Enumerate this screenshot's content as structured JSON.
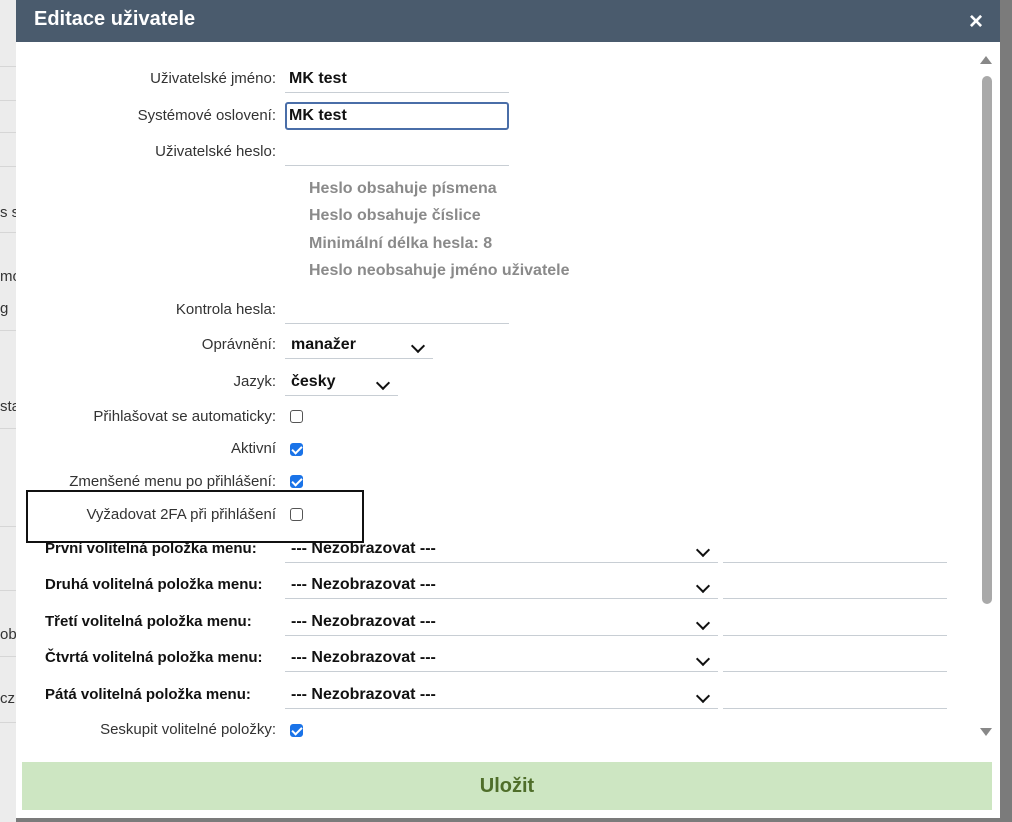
{
  "background": {
    "fragments": [
      "s s",
      "mo",
      "g",
      "sta",
      "ob",
      "cz"
    ]
  },
  "dialog": {
    "title": "Editace uživatele",
    "close_icon": "×",
    "fields": {
      "username": {
        "label": "Uživatelské jméno:",
        "value": "MK test"
      },
      "salutation": {
        "label": "Systémové oslovení:",
        "value": "MK test"
      },
      "password": {
        "label": "Uživatelské heslo:",
        "value": ""
      },
      "password_hints": [
        "Heslo obsahuje písmena",
        "Heslo obsahuje číslice",
        "Minimální délka hesla: 8",
        "Heslo neobsahuje jméno uživatele"
      ],
      "password_check": {
        "label": "Kontrola hesla:",
        "value": ""
      },
      "role": {
        "label": "Oprávnění:",
        "value": "manažer"
      },
      "language": {
        "label": "Jazyk:",
        "value": "česky"
      },
      "auto_login": {
        "label": "Přihlašovat se automaticky:",
        "checked": false
      },
      "active": {
        "label": "Aktivní",
        "checked": true
      },
      "reduced_menu": {
        "label": "Zmenšené menu po přihlášení:",
        "checked": true
      },
      "require_2fa": {
        "label": "Vyžadovat 2FA při přihlášení",
        "checked": false
      },
      "menu_items": [
        {
          "label": "První volitelná položka menu:",
          "value": "--- Nezobrazovat ---"
        },
        {
          "label": "Druhá volitelná položka menu:",
          "value": "--- Nezobrazovat ---"
        },
        {
          "label": "Třetí volitelná položka menu:",
          "value": "--- Nezobrazovat ---"
        },
        {
          "label": "Čtvrtá volitelná položka menu:",
          "value": "--- Nezobrazovat ---"
        },
        {
          "label": "Pátá volitelná položka menu:",
          "value": "--- Nezobrazovat ---"
        }
      ],
      "group_items": {
        "label": "Seskupit volitelné položky:",
        "checked": true
      }
    },
    "save_label": "Uložit"
  },
  "colors": {
    "titlebar": "#4a5b6d",
    "save_bg": "#cde6c2",
    "save_text": "#4f6e2a",
    "checkbox_on": "#1a73e8",
    "hint_text": "#8a8a8a"
  }
}
